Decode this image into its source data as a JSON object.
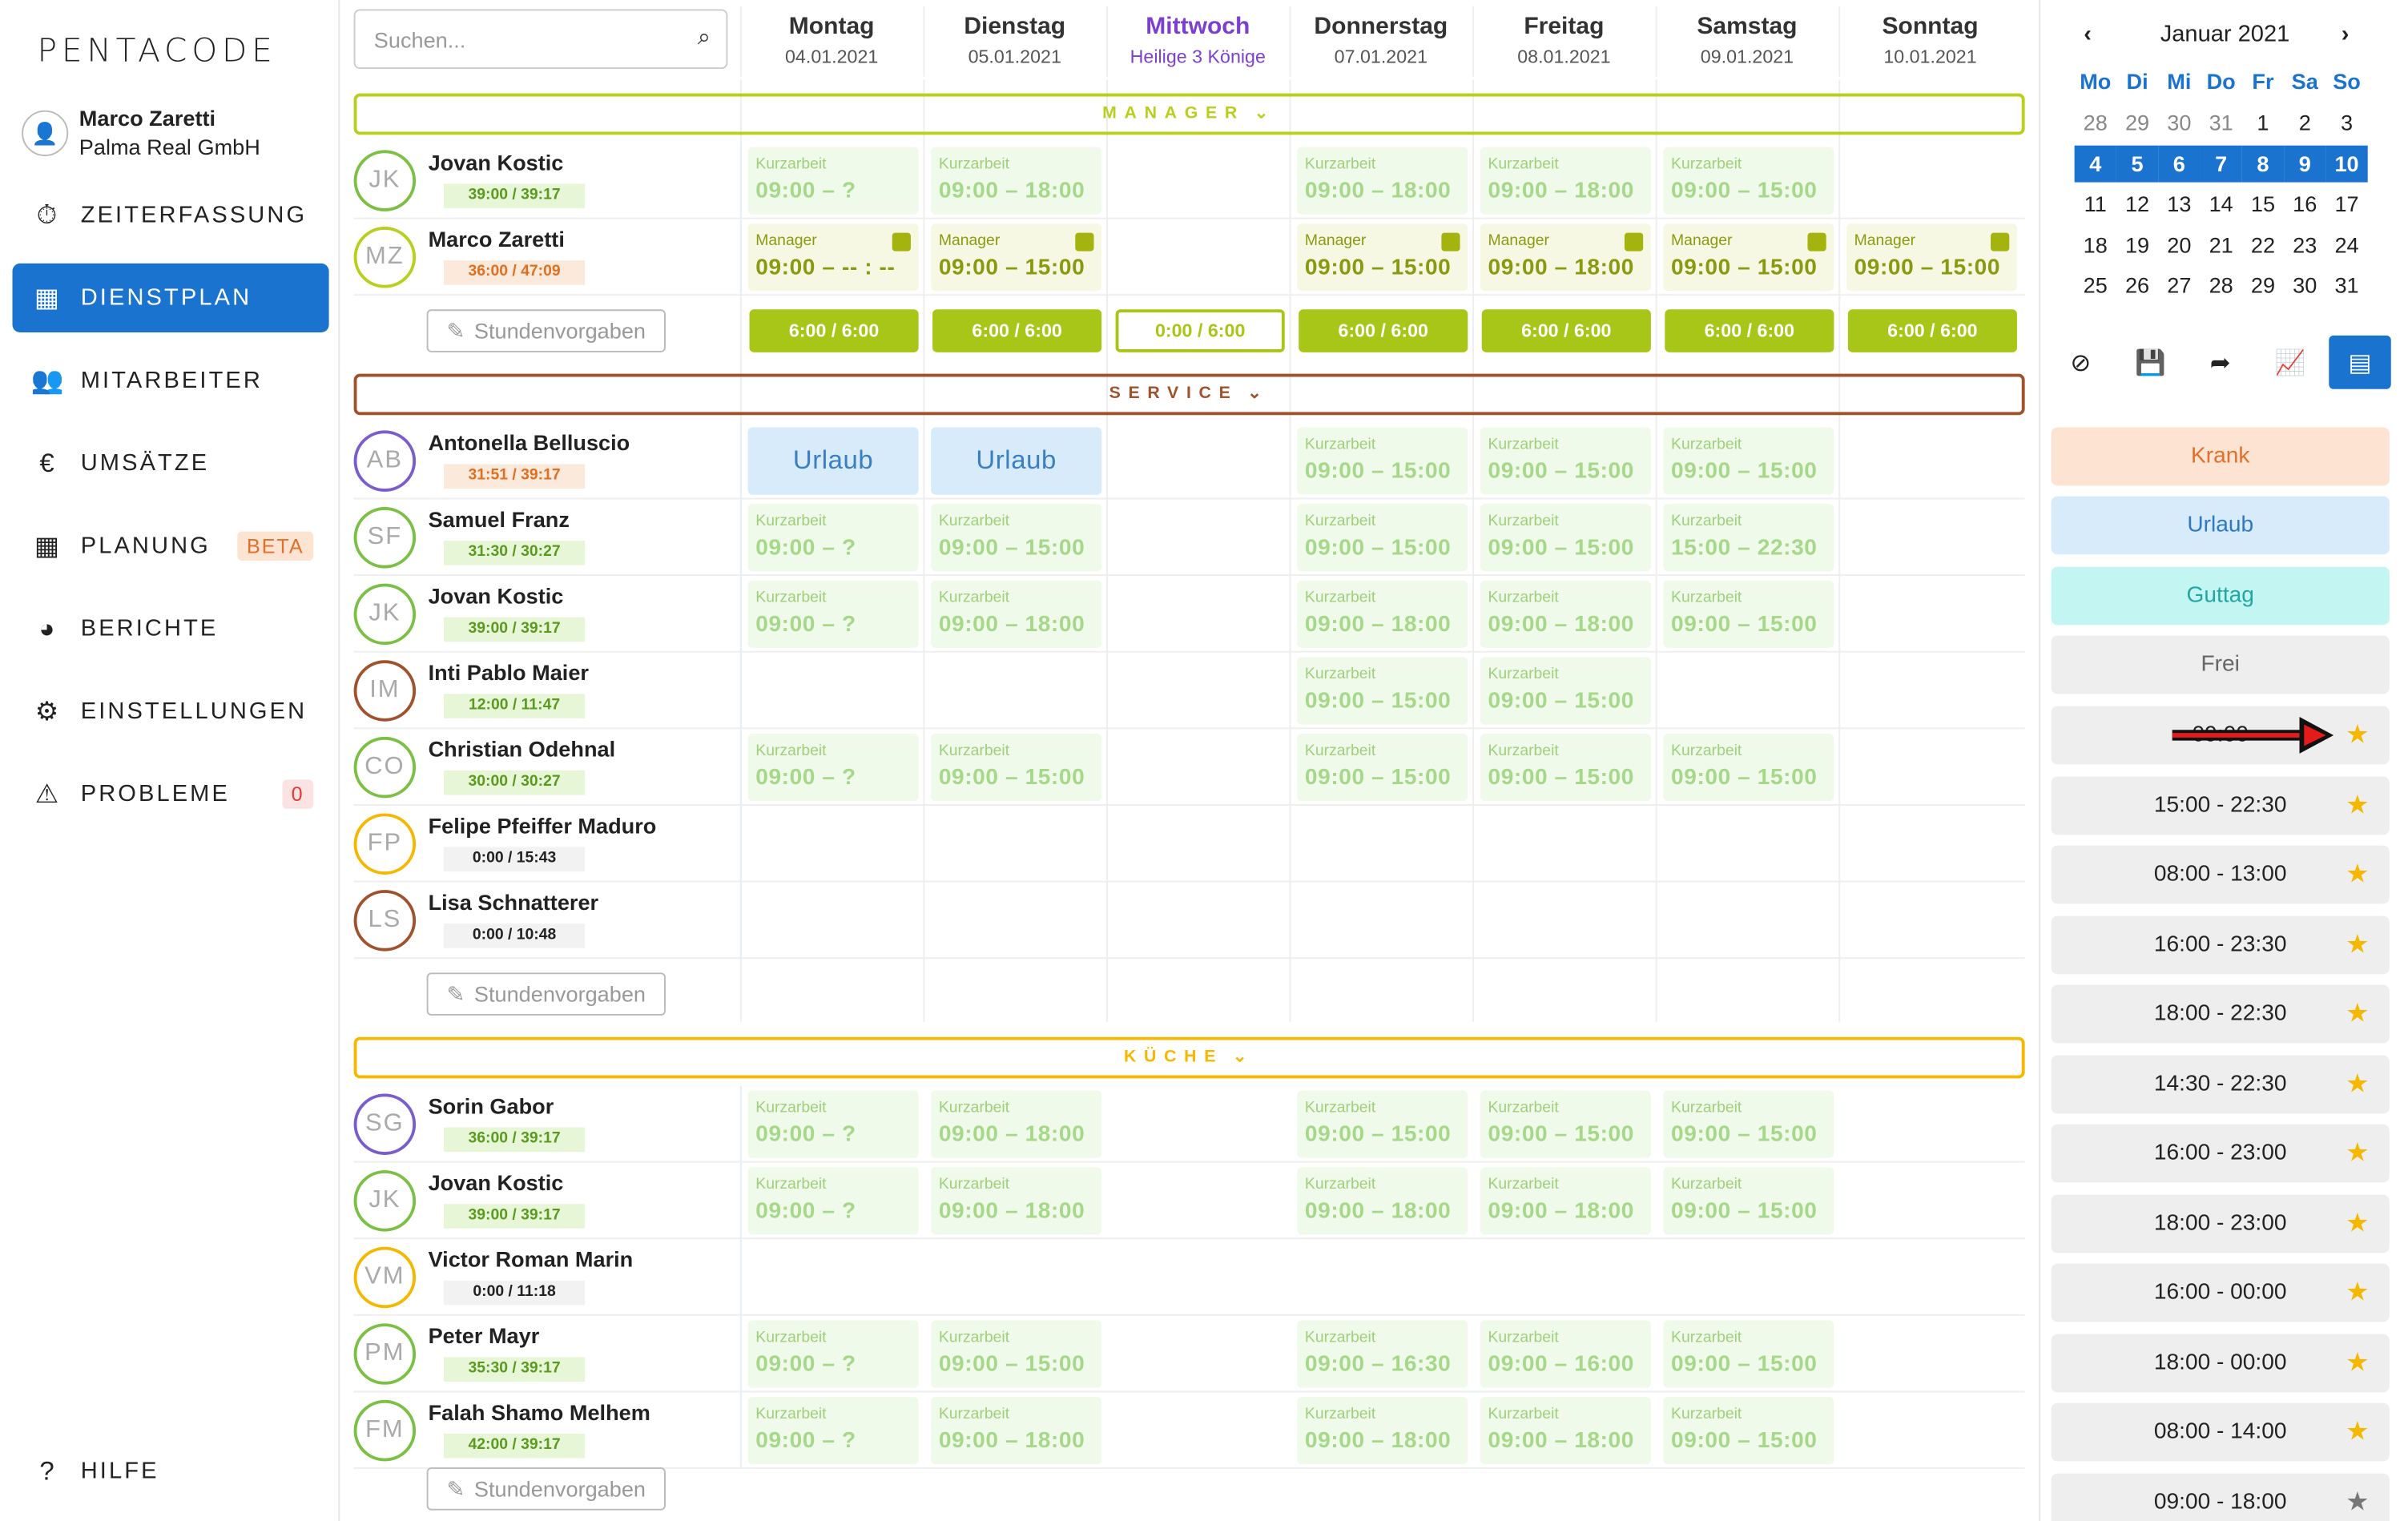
{
  "brand": "PENTACODE",
  "user": {
    "name": "Marco Zaretti",
    "company": "Palma Real GmbH"
  },
  "nav": [
    {
      "label": "ZEITERFASSUNG",
      "icon": "stopwatch-icon",
      "glyph": "⏱"
    },
    {
      "label": "DIENSTPLAN",
      "icon": "table-icon",
      "glyph": "▦"
    },
    {
      "label": "MITARBEITER",
      "icon": "users-icon",
      "glyph": "👥"
    },
    {
      "label": "UMSÄTZE",
      "icon": "euro-icon",
      "glyph": "€"
    },
    {
      "label": "PLANUNG",
      "icon": "calendar-icon",
      "glyph": "▦",
      "badge": "BETA"
    },
    {
      "label": "BERICHTE",
      "icon": "pie-chart-icon",
      "glyph": "◕"
    },
    {
      "label": "EINSTELLUNGEN",
      "icon": "gear-icon",
      "glyph": "⚙"
    },
    {
      "label": "PROBLEME",
      "icon": "warning-icon",
      "glyph": "⚠",
      "badge": "0"
    }
  ],
  "help": "HILFE",
  "search": {
    "placeholder": "Suchen..."
  },
  "days": [
    {
      "name": "Montag",
      "date": "04.01.2021"
    },
    {
      "name": "Dienstag",
      "date": "05.01.2021"
    },
    {
      "name": "Mittwoch",
      "date": "Heilige 3 Könige"
    },
    {
      "name": "Donnerstag",
      "date": "07.01.2021"
    },
    {
      "name": "Freitag",
      "date": "08.01.2021"
    },
    {
      "name": "Samstag",
      "date": "09.01.2021"
    },
    {
      "name": "Sonntag",
      "date": "10.01.2021"
    }
  ],
  "sections": [
    {
      "title": "MANAGER",
      "color": "#b8cf1c",
      "rows": [
        {
          "initials": "JK",
          "name": "Jovan Kostic",
          "hours": "39:00 / 39:17",
          "hstyle": "g",
          "ring": "#7bc043",
          "cells": [
            [
              "Kurzarbeit",
              "09:00 – ?"
            ],
            [
              "Kurzarbeit",
              "09:00 – 18:00"
            ],
            null,
            [
              "Kurzarbeit",
              "09:00 – 18:00"
            ],
            [
              "Kurzarbeit",
              "09:00 – 18:00"
            ],
            [
              "Kurzarbeit",
              "09:00 – 15:00"
            ],
            null
          ]
        },
        {
          "initials": "MZ",
          "name": "Marco Zaretti",
          "hours": "36:00 / 47:09",
          "hstyle": "o",
          "ring": "#b8cf1c",
          "cells": [
            [
              "Manager",
              "09:00 – -- : --",
              "mgr"
            ],
            [
              "Manager",
              "09:00 – 15:00",
              "mgr"
            ],
            null,
            [
              "Manager",
              "09:00 – 15:00",
              "mgr"
            ],
            [
              "Manager",
              "09:00 – 18:00",
              "mgr"
            ],
            [
              "Manager",
              "09:00 – 15:00",
              "mgr"
            ],
            [
              "Manager",
              "09:00 – 15:00",
              "mgr"
            ]
          ]
        }
      ],
      "sums": [
        "6:00 / 6:00",
        "6:00 / 6:00",
        "0:00 / 6:00",
        "6:00 / 6:00",
        "6:00 / 6:00",
        "6:00 / 6:00",
        "6:00 / 6:00"
      ]
    },
    {
      "title": "SERVICE",
      "color": "#a0522d",
      "rows": [
        {
          "initials": "AB",
          "name": "Antonella Belluscio",
          "hours": "31:51 / 39:17",
          "hstyle": "o",
          "ring": "#7b5ccf",
          "cells": [
            [
              "",
              "Urlaub",
              "url"
            ],
            [
              "",
              "Urlaub",
              "url"
            ],
            null,
            [
              "Kurzarbeit",
              "09:00 – 15:00"
            ],
            [
              "Kurzarbeit",
              "09:00 – 15:00"
            ],
            [
              "Kurzarbeit",
              "09:00 – 15:00"
            ],
            null
          ]
        },
        {
          "initials": "SF",
          "name": "Samuel Franz",
          "hours": "31:30 / 30:27",
          "hstyle": "g",
          "ring": "#7bc043",
          "cells": [
            [
              "Kurzarbeit",
              "09:00 – ?"
            ],
            [
              "Kurzarbeit",
              "09:00 – 15:00"
            ],
            null,
            [
              "Kurzarbeit",
              "09:00 – 15:00"
            ],
            [
              "Kurzarbeit",
              "09:00 – 15:00"
            ],
            [
              "Kurzarbeit",
              "15:00 – 22:30"
            ],
            null
          ]
        },
        {
          "initials": "JK",
          "name": "Jovan Kostic",
          "hours": "39:00 / 39:17",
          "hstyle": "g",
          "ring": "#7bc043",
          "cells": [
            [
              "Kurzarbeit",
              "09:00 – ?"
            ],
            [
              "Kurzarbeit",
              "09:00 – 18:00"
            ],
            null,
            [
              "Kurzarbeit",
              "09:00 – 18:00"
            ],
            [
              "Kurzarbeit",
              "09:00 – 18:00"
            ],
            [
              "Kurzarbeit",
              "09:00 – 15:00"
            ],
            null
          ]
        },
        {
          "initials": "IM",
          "name": "Inti Pablo Maier",
          "hours": "12:00 / 11:47",
          "hstyle": "g",
          "ring": "#a0522d",
          "cells": [
            null,
            null,
            null,
            [
              "Kurzarbeit",
              "09:00 – 15:00"
            ],
            [
              "Kurzarbeit",
              "09:00 – 15:00"
            ],
            null,
            null
          ]
        },
        {
          "initials": "CO",
          "name": "Christian Odehnal",
          "hours": "30:00 / 30:27",
          "hstyle": "g",
          "ring": "#7bc043",
          "cells": [
            [
              "Kurzarbeit",
              "09:00 – ?"
            ],
            [
              "Kurzarbeit",
              "09:00 – 15:00"
            ],
            null,
            [
              "Kurzarbeit",
              "09:00 – 15:00"
            ],
            [
              "Kurzarbeit",
              "09:00 – 15:00"
            ],
            [
              "Kurzarbeit",
              "09:00 – 15:00"
            ],
            null
          ]
        },
        {
          "initials": "FP",
          "name": "Felipe Pfeiffer Maduro",
          "hours": "0:00 / 15:43",
          "hstyle": "",
          "ring": "#f6b700",
          "cells": [
            null,
            null,
            null,
            null,
            null,
            null,
            null
          ]
        },
        {
          "initials": "LS",
          "name": "Lisa Schnatterer",
          "hours": "0:00 / 10:48",
          "hstyle": "",
          "ring": "#a0522d",
          "cells": [
            null,
            null,
            null,
            null,
            null,
            null,
            null
          ]
        }
      ]
    },
    {
      "title": "KÜCHE",
      "color": "#f6b700",
      "rows": [
        {
          "initials": "SG",
          "name": "Sorin Gabor",
          "hours": "36:00 / 39:17",
          "hstyle": "g",
          "ring": "#7b5ccf",
          "cells": [
            [
              "Kurzarbeit",
              "09:00 – ?"
            ],
            [
              "Kurzarbeit",
              "09:00 – 18:00"
            ],
            null,
            [
              "Kurzarbeit",
              "09:00 – 15:00"
            ],
            [
              "Kurzarbeit",
              "09:00 – 15:00"
            ],
            [
              "Kurzarbeit",
              "09:00 – 15:00"
            ],
            null
          ]
        },
        {
          "initials": "JK",
          "name": "Jovan Kostic",
          "hours": "39:00 / 39:17",
          "hstyle": "g",
          "ring": "#7bc043",
          "cells": [
            [
              "Kurzarbeit",
              "09:00 – ?"
            ],
            [
              "Kurzarbeit",
              "09:00 – 18:00"
            ],
            null,
            [
              "Kurzarbeit",
              "09:00 – 18:00"
            ],
            [
              "Kurzarbeit",
              "09:00 – 18:00"
            ],
            [
              "Kurzarbeit",
              "09:00 – 15:00"
            ],
            null
          ]
        },
        {
          "initials": "VM",
          "name": "Victor Roman Marin",
          "hours": "0:00 / 11:18",
          "hstyle": "",
          "ring": "#f6b700",
          "cells": [
            null,
            null,
            null,
            null,
            null,
            null,
            null
          ]
        },
        {
          "initials": "PM",
          "name": "Peter Mayr",
          "hours": "35:30 / 39:17",
          "hstyle": "g",
          "ring": "#7bc043",
          "cells": [
            [
              "Kurzarbeit",
              "09:00 – ?"
            ],
            [
              "Kurzarbeit",
              "09:00 – 15:00"
            ],
            null,
            [
              "Kurzarbeit",
              "09:00 – 16:30"
            ],
            [
              "Kurzarbeit",
              "09:00 – 16:00"
            ],
            [
              "Kurzarbeit",
              "09:00 – 15:00"
            ],
            null
          ]
        },
        {
          "initials": "FM",
          "name": "Falah Shamo Melhem",
          "hours": "42:00 / 39:17",
          "hstyle": "g",
          "ring": "#7bc043",
          "cells": [
            [
              "Kurzarbeit",
              "09:00 – ?"
            ],
            [
              "Kurzarbeit",
              "09:00 – 18:00"
            ],
            null,
            [
              "Kurzarbeit",
              "09:00 – 18:00"
            ],
            [
              "Kurzarbeit",
              "09:00 – 18:00"
            ],
            [
              "Kurzarbeit",
              "09:00 – 15:00"
            ],
            null
          ]
        }
      ]
    }
  ],
  "stundenvorgaben": "Stundenvorgaben",
  "calendar": {
    "title": "Januar 2021",
    "dow": [
      "Mo",
      "Di",
      "Mi",
      "Do",
      "Fr",
      "Sa",
      "So"
    ],
    "weeks": [
      [
        "28",
        "29",
        "30",
        "31",
        "1",
        "2",
        "3"
      ],
      [
        "4",
        "5",
        "6",
        "7",
        "8",
        "9",
        "10"
      ],
      [
        "11",
        "12",
        "13",
        "14",
        "15",
        "16",
        "17"
      ],
      [
        "18",
        "19",
        "20",
        "21",
        "22",
        "23",
        "24"
      ],
      [
        "25",
        "26",
        "27",
        "28",
        "29",
        "30",
        "31"
      ]
    ]
  },
  "tags": [
    {
      "label": "Krank",
      "bg": "#fde3d2",
      "fg": "#e0702a"
    },
    {
      "label": "Urlaub",
      "bg": "#d7ebfa",
      "fg": "#2f79c2"
    },
    {
      "label": "Guttag",
      "bg": "#c3f6f3",
      "fg": "#22a6a0"
    },
    {
      "label": "Frei",
      "bg": "#eeeeee",
      "fg": "#666666"
    }
  ],
  "shifts": [
    {
      "label": "09:00",
      "star": "gold"
    },
    {
      "label": "15:00 - 22:30",
      "star": "gold"
    },
    {
      "label": "08:00 - 13:00",
      "star": "gold"
    },
    {
      "label": "16:00 - 23:30",
      "star": "gold"
    },
    {
      "label": "18:00 - 22:30",
      "star": "gold"
    },
    {
      "label": "14:30 - 22:30",
      "star": "gold"
    },
    {
      "label": "16:00 - 23:00",
      "star": "gold"
    },
    {
      "label": "18:00 - 23:00",
      "star": "gold"
    },
    {
      "label": "16:00 - 00:00",
      "star": "gold"
    },
    {
      "label": "18:00 - 00:00",
      "star": "gold"
    },
    {
      "label": "08:00 - 14:00",
      "star": "gold"
    },
    {
      "label": "09:00 - 18:00",
      "star": "grey"
    }
  ]
}
